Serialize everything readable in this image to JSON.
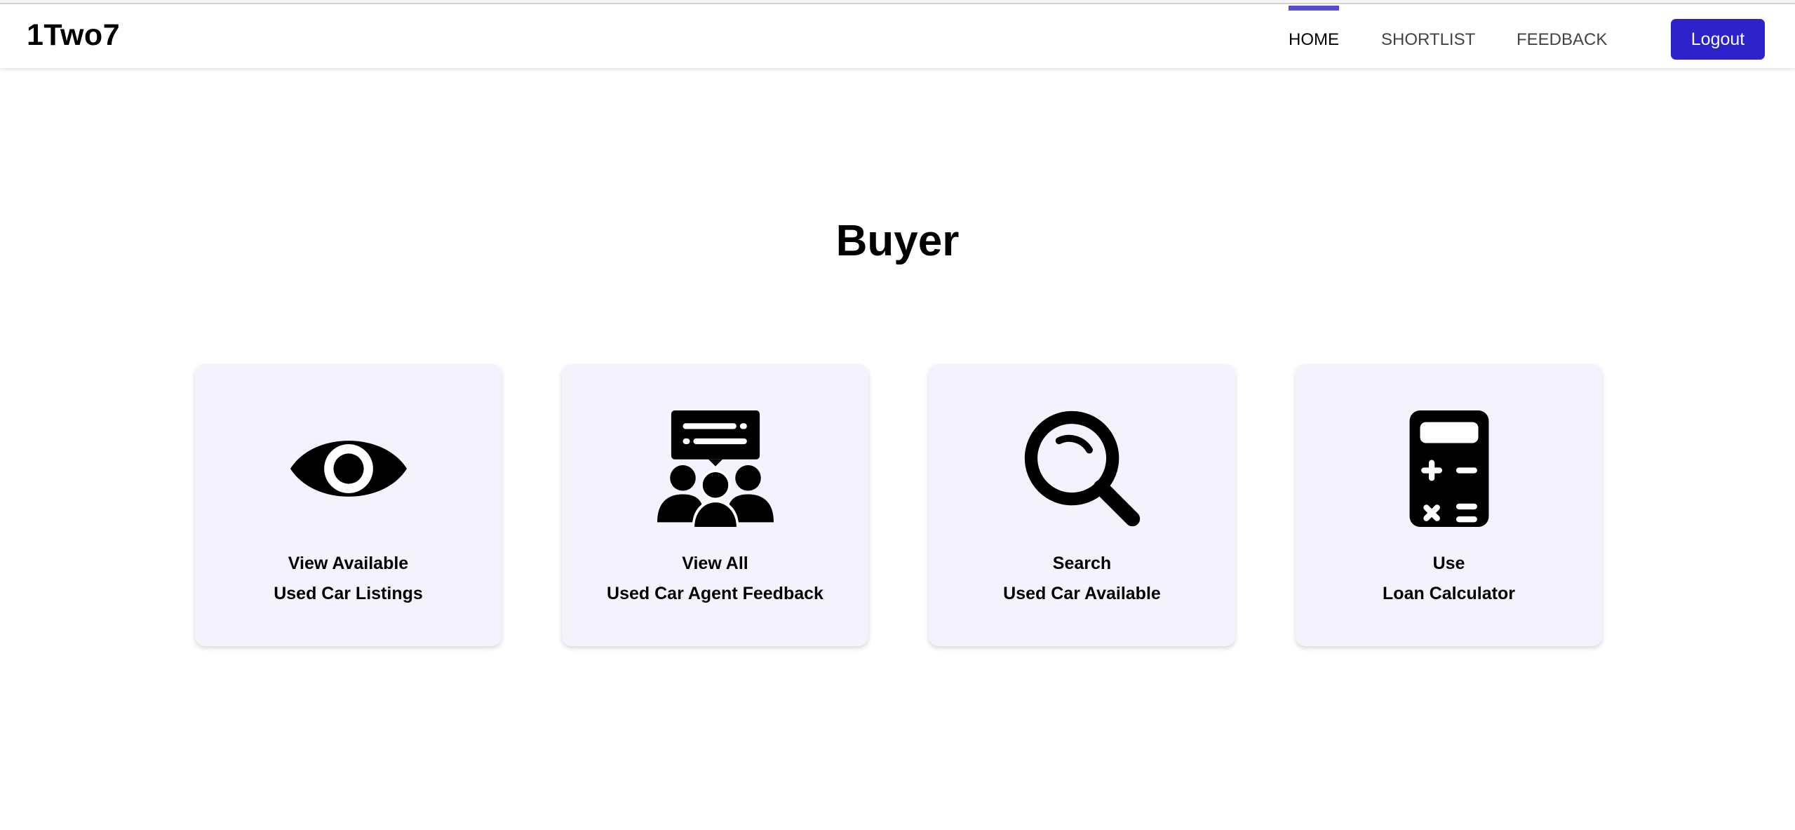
{
  "header": {
    "brand": "1Two7",
    "nav": [
      {
        "label": "HOME",
        "active": true
      },
      {
        "label": "SHORTLIST",
        "active": false
      },
      {
        "label": "FEEDBACK",
        "active": false
      }
    ],
    "logout_label": "Logout"
  },
  "main": {
    "title": "Buyer",
    "cards": [
      {
        "icon": "eye-icon",
        "line1": "View Available",
        "line2": "Used Car Listings"
      },
      {
        "icon": "people-feedback-icon",
        "line1": "View All",
        "line2": "Used Car Agent Feedback"
      },
      {
        "icon": "magnifier-icon",
        "line1": "Search",
        "line2": "Used Car Available"
      },
      {
        "icon": "calculator-icon",
        "line1": "Use",
        "line2": "Loan Calculator"
      }
    ]
  },
  "colors": {
    "accent": "#2d22c9",
    "active_indicator": "#5b4bd4",
    "card_background": "#f4f3fd"
  }
}
